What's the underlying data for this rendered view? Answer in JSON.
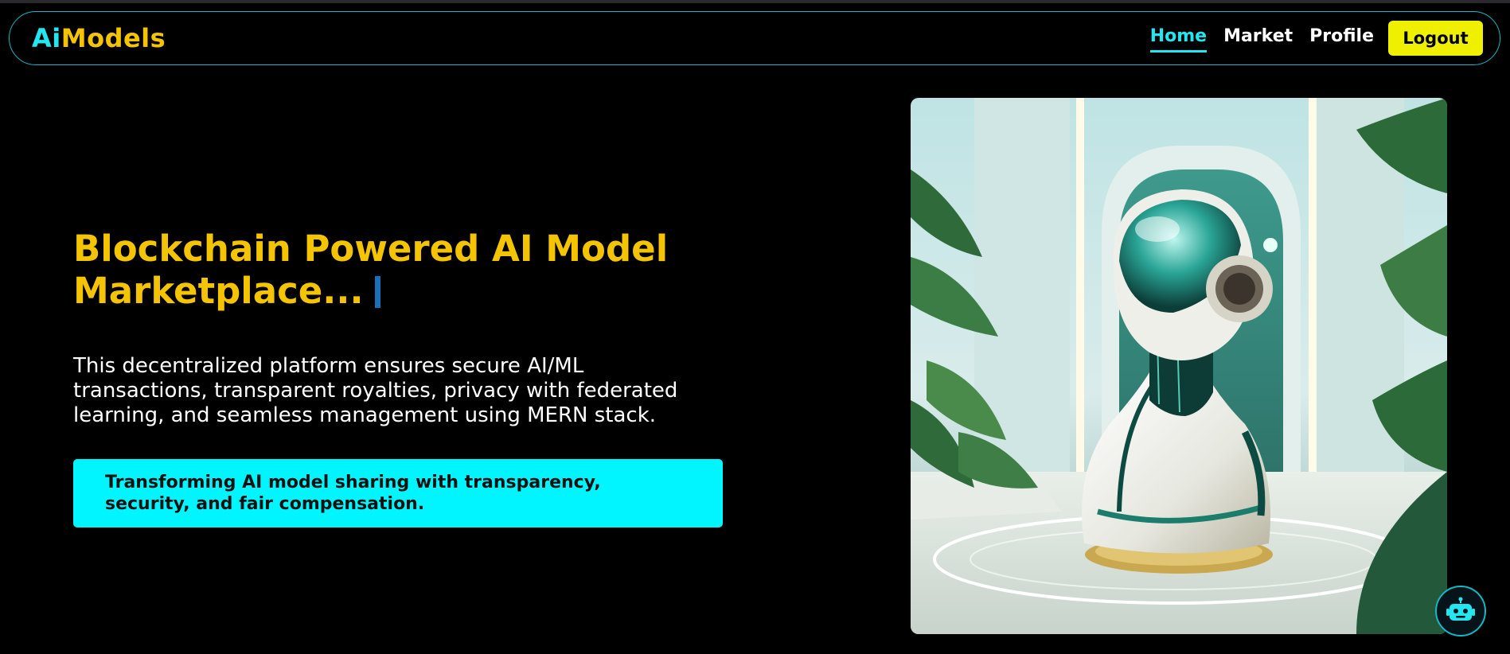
{
  "brand": {
    "logo_prefix": "Ai",
    "logo_suffix": "Models"
  },
  "nav": {
    "links": [
      {
        "label": "Home",
        "active": true
      },
      {
        "label": "Market",
        "active": false
      },
      {
        "label": "Profile",
        "active": false
      }
    ],
    "logout_label": "Logout"
  },
  "hero": {
    "title": "Blockchain Powered AI Model Marketplace...",
    "description": "This decentralized platform ensures secure AI/ML transactions, transparent royalties, privacy with federated learning, and seamless management using MERN stack.",
    "tagline": "Transforming AI model sharing with transparency, security, and fair compensation.",
    "image_subject": "robot-illustration"
  },
  "chatbot": {
    "icon": "robot-icon"
  },
  "colors": {
    "background": "#000000",
    "accent_cyan": "#22e6f0",
    "accent_yellow": "#f5c400",
    "logout_bg": "#eef000",
    "tagline_bg": "#00f5ff"
  }
}
